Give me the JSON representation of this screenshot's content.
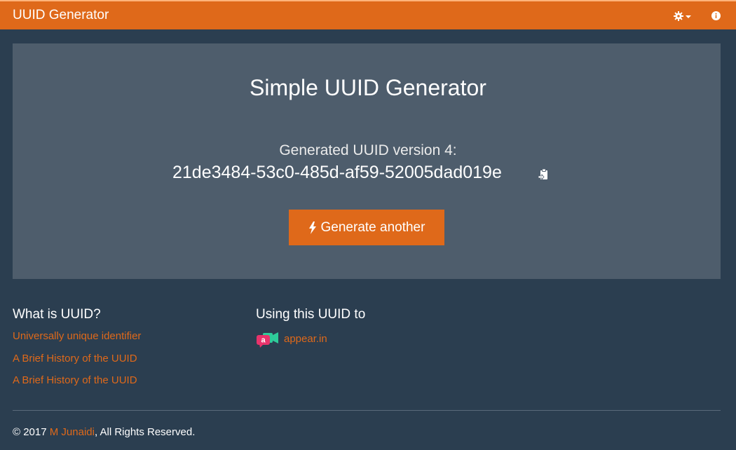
{
  "navbar": {
    "brand": "UUID Generator",
    "icons": {
      "settings": "gear-icon",
      "dropdown": "caret-down-icon",
      "info": "info-icon"
    },
    "color": "#df691a"
  },
  "hero": {
    "title": "Simple UUID Generator",
    "generated_label": "Generated UUID version 4:",
    "uuid": "21de3484-53c0-485d-af59-52005dad019e",
    "copy_icon": "clipboard-icon",
    "button_icon": "bolt-icon",
    "button_label": "Generate another"
  },
  "what_is": {
    "heading": "What is UUID?",
    "links": [
      "Universally unique identifier",
      "A Brief History of the UUID",
      "A Brief History of the UUID"
    ]
  },
  "using": {
    "heading": "Using this UUID to",
    "links": [
      {
        "icon": "appear-in-logo-icon",
        "label": "appear.in"
      }
    ]
  },
  "footer": {
    "prefix": "© 2017 ",
    "author": "M Junaidi",
    "suffix": ", All Rights Reserved."
  },
  "colors": {
    "background": "#2b3e50",
    "panel": "#4e5d6c",
    "accent": "#df691a"
  }
}
